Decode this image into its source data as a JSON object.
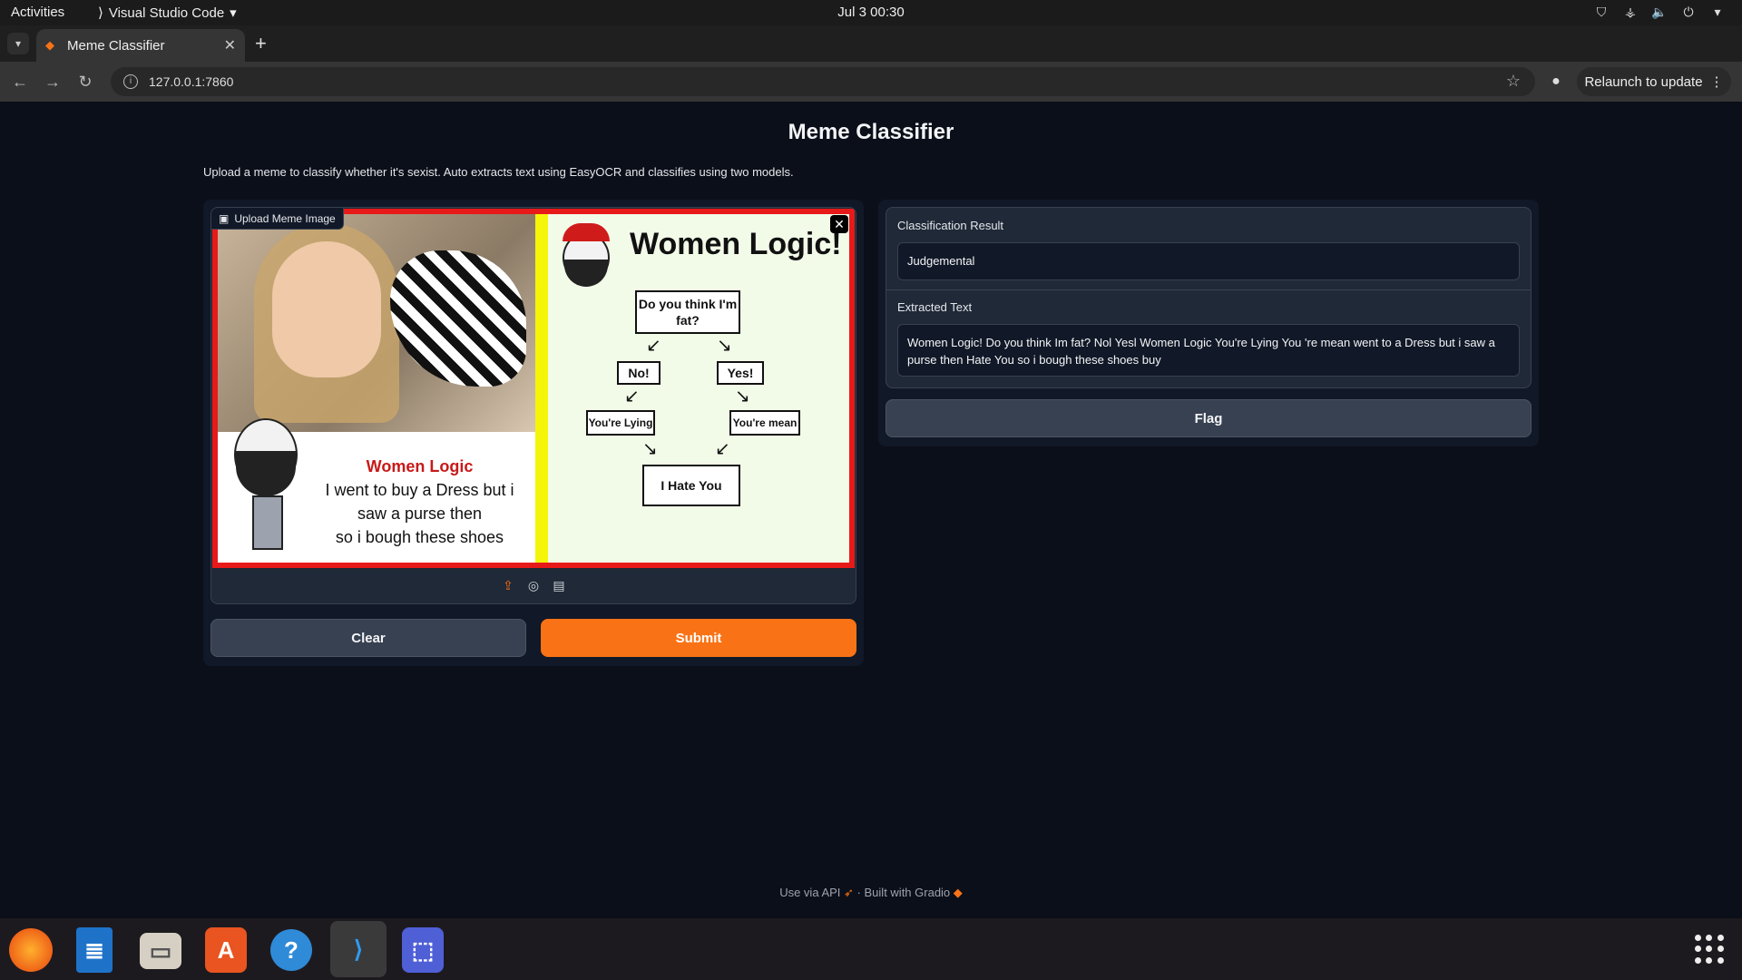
{
  "system": {
    "activities": "Activities",
    "app_name": "Visual Studio Code",
    "clock": "Jul 3  00:30"
  },
  "browser": {
    "tab_title": "Meme Classifier",
    "url": "127.0.0.1:7860",
    "relaunch_label": "Relaunch to update"
  },
  "page": {
    "title": "Meme Classifier",
    "description": "Upload a meme to classify whether it's sexist. Auto extracts text using EasyOCR and classifies using two models."
  },
  "input": {
    "image_label": "Upload Meme Image",
    "clear_label": "Clear",
    "submit_label": "Submit"
  },
  "meme": {
    "left_heading": "Women Logic",
    "left_lines": [
      "I went to buy a Dress but i",
      "saw a purse then",
      "so i bough these shoes"
    ],
    "right_title": "Women Logic!",
    "q": "Do you think I'm fat?",
    "no": "No!",
    "yes": "Yes!",
    "lying": "You're Lying",
    "mean": "You're mean",
    "hate": "I Hate You"
  },
  "output": {
    "result_label": "Classification Result",
    "result_value": "Judgemental",
    "text_label": "Extracted Text",
    "text_value": "Women Logic! Do you think Im fat? Nol Yesl Women Logic You're Lying You 're mean went to a Dress but i saw a purse then Hate You so i bough these shoes buy",
    "flag_label": "Flag"
  },
  "footer": {
    "api": "Use via API",
    "sep": "·",
    "built": "Built with Gradio"
  },
  "colors": {
    "accent": "#f97316",
    "background": "#0b0f19",
    "panel": "#111827"
  }
}
